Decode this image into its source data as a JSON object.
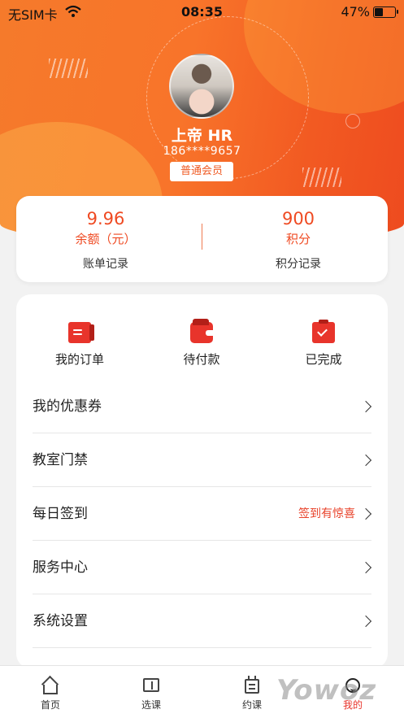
{
  "status_bar": {
    "carrier": "无SIM卡",
    "time": "08:35",
    "battery": "47%",
    "battery_level": 0.47
  },
  "profile": {
    "name": "上帝 HR",
    "phone": "186****9657",
    "member_level": "普通会员"
  },
  "stats": {
    "balance_value": "9.96",
    "balance_label": "余额（元）",
    "balance_link": "账单记录",
    "points_value": "900",
    "points_label": "积分",
    "points_link": "积分记录"
  },
  "orders": [
    {
      "label": "我的订单",
      "icon": "order-list-icon"
    },
    {
      "label": "待付款",
      "icon": "wallet-icon"
    },
    {
      "label": "已完成",
      "icon": "clipboard-check-icon"
    }
  ],
  "menu": [
    {
      "label": "我的优惠券",
      "hint": ""
    },
    {
      "label": "教室门禁",
      "hint": ""
    },
    {
      "label": "每日签到",
      "hint": "签到有惊喜"
    },
    {
      "label": "服务中心",
      "hint": ""
    },
    {
      "label": "系统设置",
      "hint": ""
    }
  ],
  "tabs": [
    {
      "label": "首页",
      "icon": "home-icon"
    },
    {
      "label": "选课",
      "icon": "book-icon"
    },
    {
      "label": "约课",
      "icon": "calendar-icon"
    },
    {
      "label": "我的",
      "icon": "profile-icon",
      "active": true
    }
  ],
  "watermark": "Yowoz",
  "colors": {
    "accent": "#ef4a22",
    "header_start": "#f57a2b",
    "header_end": "#ee4b1f"
  }
}
